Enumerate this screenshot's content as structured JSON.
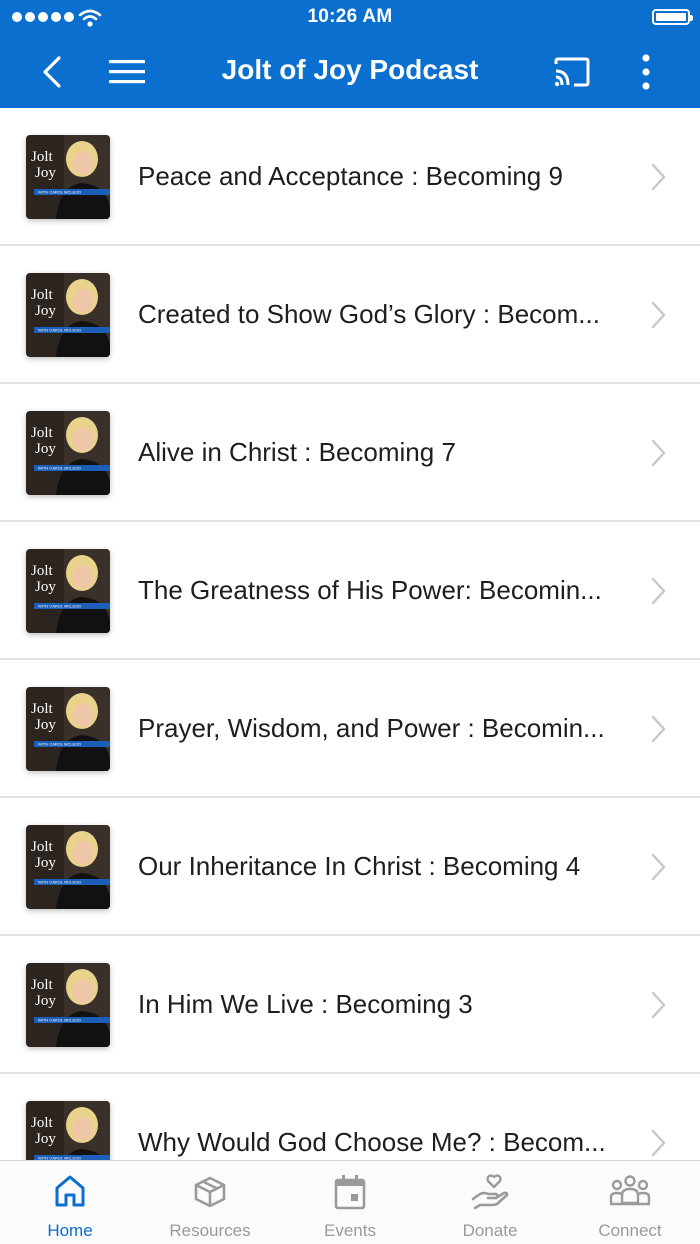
{
  "status_bar": {
    "time": "10:26 AM"
  },
  "header": {
    "title": "Jolt of Joy Podcast"
  },
  "thumbnail_text": {
    "line1": "Jolt",
    "line2": "Joy",
    "tag": "WITH CAROL MCLEOD"
  },
  "episodes": [
    {
      "title": "Peace and Acceptance : Becoming 9"
    },
    {
      "title": "Created to Show God’s Glory : Becom..."
    },
    {
      "title": "Alive in Christ : Becoming 7"
    },
    {
      "title": "The Greatness of His Power: Becomin..."
    },
    {
      "title": "Prayer, Wisdom, and Power : Becomin..."
    },
    {
      "title": "Our Inheritance In Christ : Becoming 4"
    },
    {
      "title": "In Him We Live : Becoming 3"
    },
    {
      "title": "Why Would God Choose Me? : Becom..."
    }
  ],
  "tabbar": {
    "items": [
      {
        "label": "Home",
        "icon": "home-icon",
        "active": true
      },
      {
        "label": "Resources",
        "icon": "box-icon",
        "active": false
      },
      {
        "label": "Events",
        "icon": "calendar-icon",
        "active": false
      },
      {
        "label": "Donate",
        "icon": "hand-heart-icon",
        "active": false
      },
      {
        "label": "Connect",
        "icon": "people-icon",
        "active": false
      }
    ]
  },
  "colors": {
    "accent": "#0a6fce",
    "inactive": "#9a9a9a"
  }
}
